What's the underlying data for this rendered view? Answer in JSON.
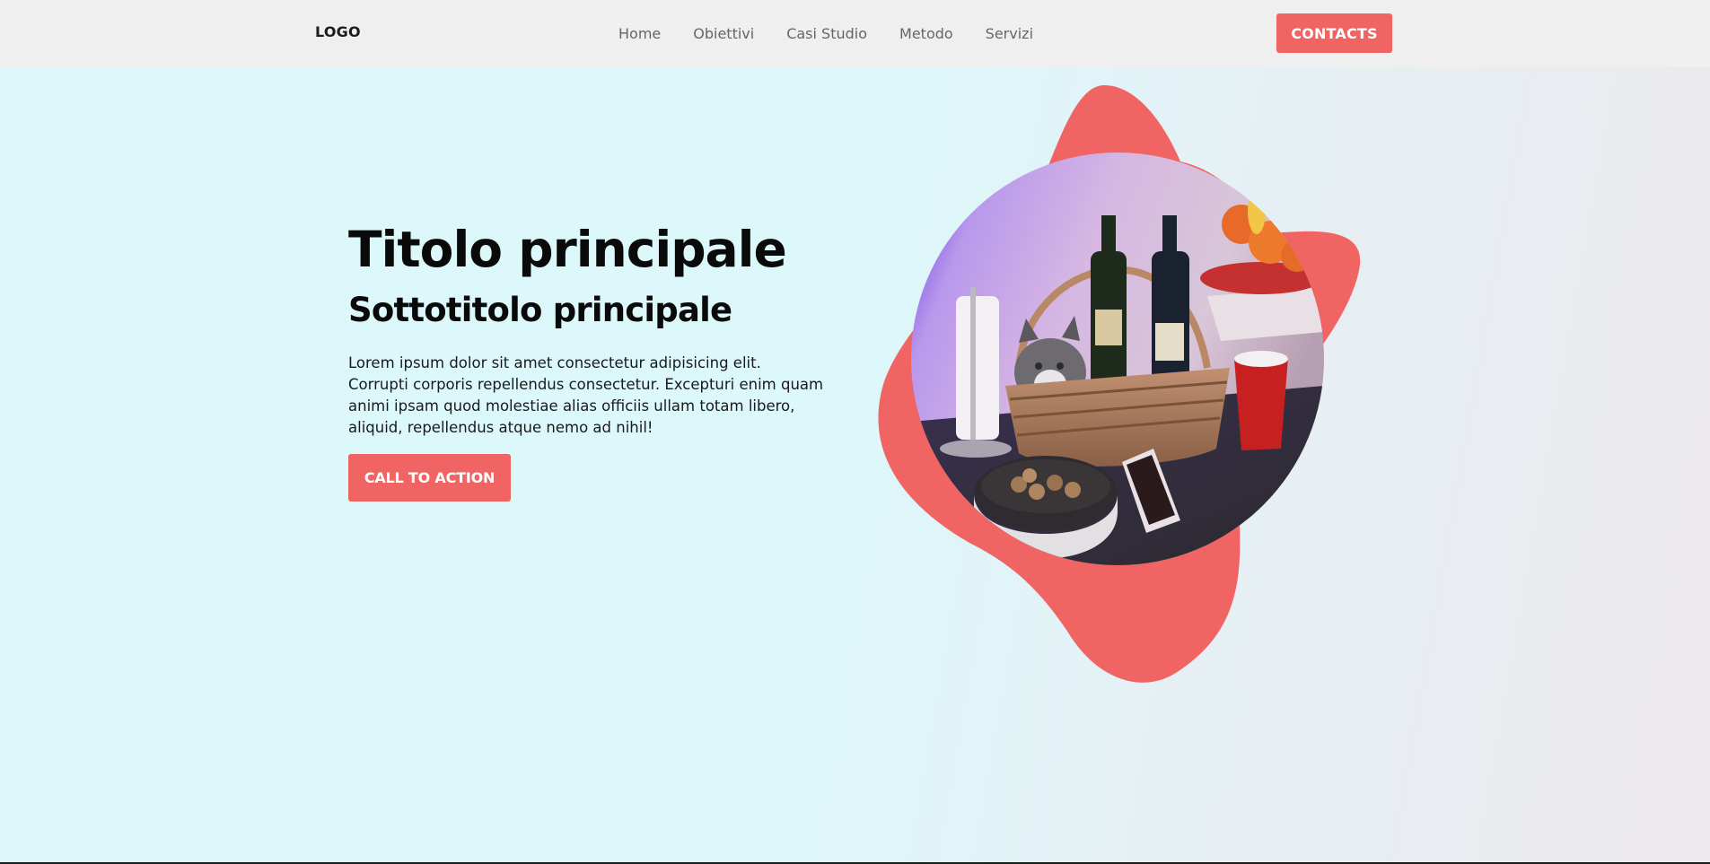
{
  "navbar": {
    "logo": "LOGO",
    "links": [
      "Home",
      "Obiettivi",
      "Casi Studio",
      "Metodo",
      "Servizi"
    ],
    "contacts_label": "CONTACTS"
  },
  "hero": {
    "title": "Titolo principale",
    "subtitle": "Sottotitolo principale",
    "paragraph": "Lorem ipsum dolor sit amet consectetur adipisicing elit. Corrupti corporis repellendus consectetur. Excepturi enim quam animi ipsam quod molestiae alias officiis ullam totam libero, aliquid, repellendus atque nemo ad nihil!",
    "cta_label": "CALL TO ACTION"
  },
  "colors": {
    "accent": "#f06464",
    "background": "#dcf8fb",
    "navbar": "#efefef"
  }
}
